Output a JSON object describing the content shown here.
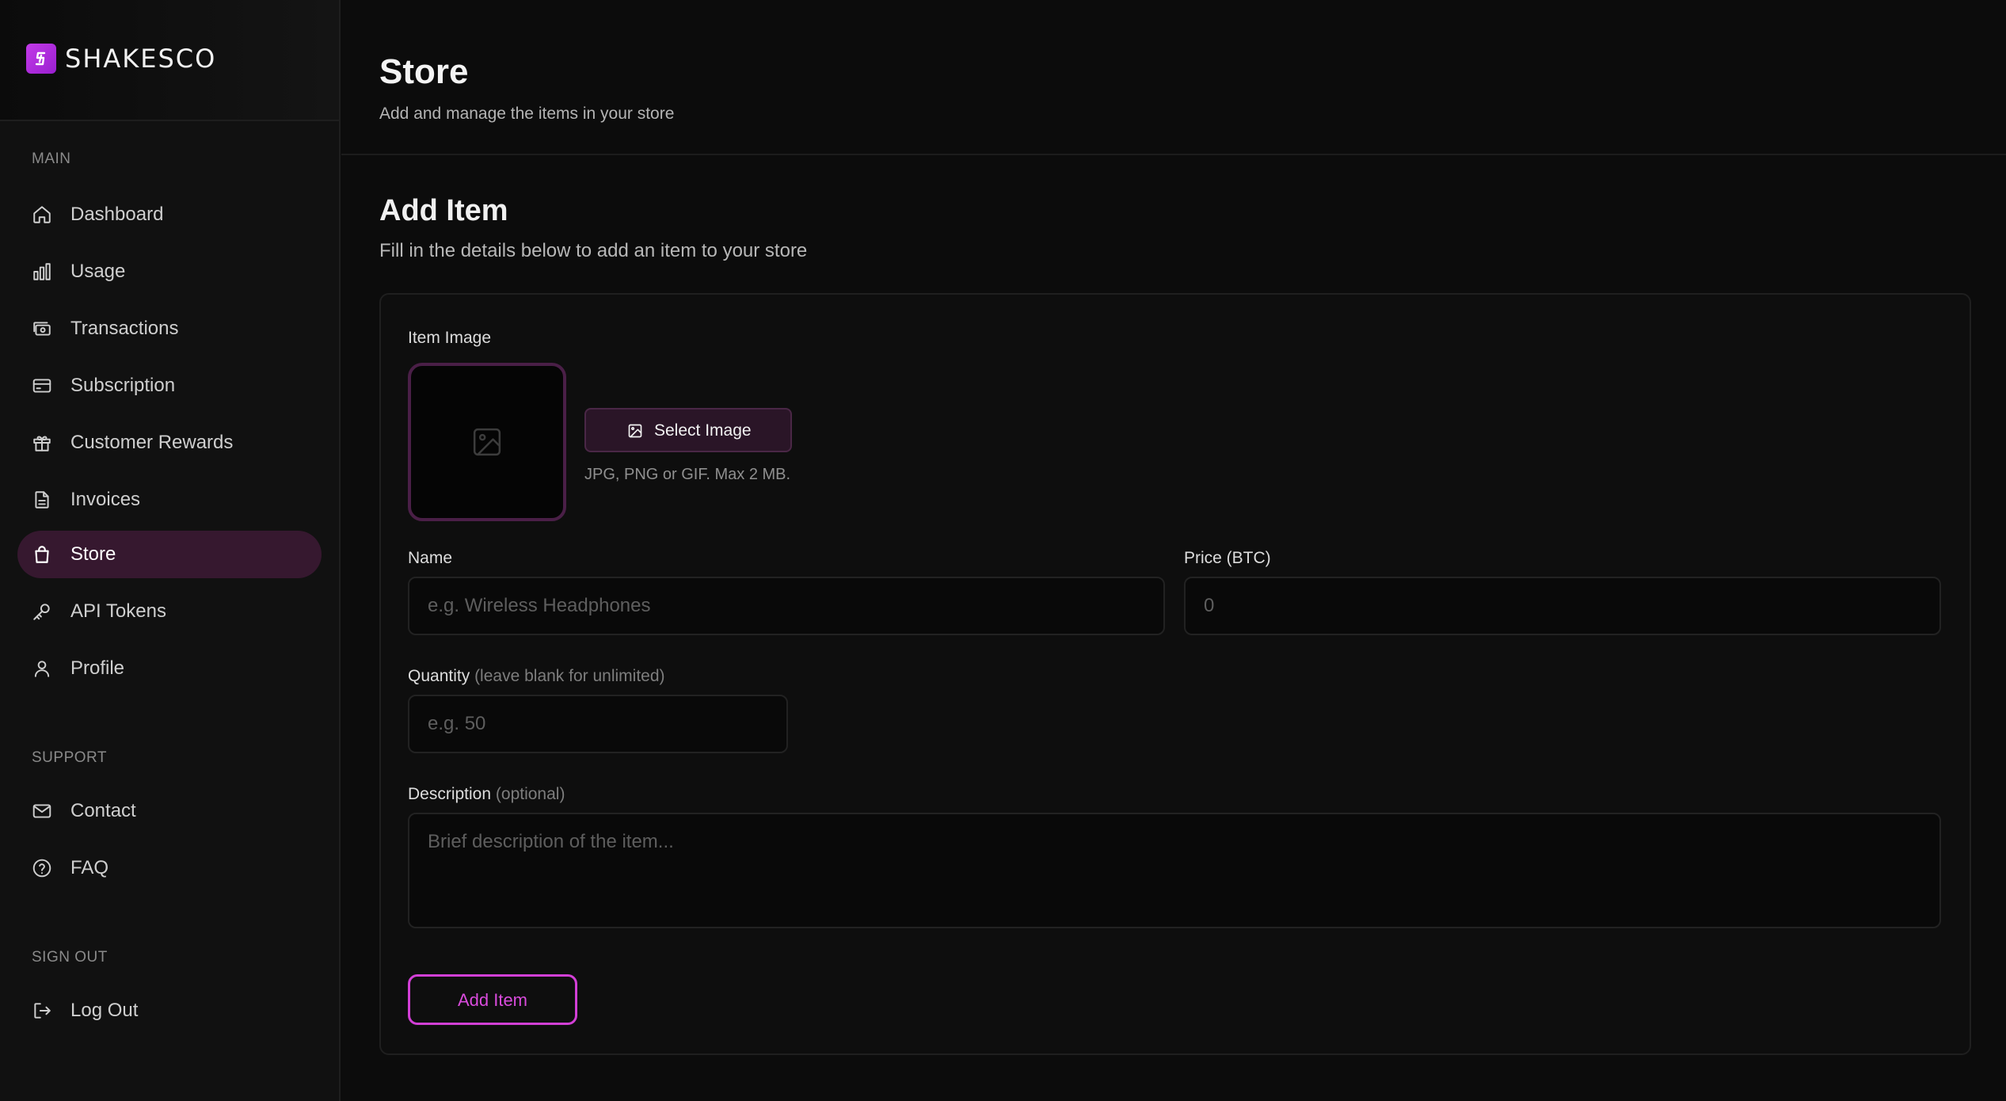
{
  "brand": {
    "name": "SHAKESCO",
    "icon": "brand-logo-icon",
    "accent": "#c23ae8"
  },
  "sidebar": {
    "sections": [
      {
        "title": "MAIN",
        "items": [
          {
            "label": "Dashboard",
            "icon": "home-icon",
            "active": false
          },
          {
            "label": "Usage",
            "icon": "bar-chart-icon",
            "active": false
          },
          {
            "label": "Transactions",
            "icon": "banknote-icon",
            "active": false
          },
          {
            "label": "Subscription",
            "icon": "credit-card-icon",
            "active": false
          },
          {
            "label": "Customer Rewards",
            "icon": "gift-icon",
            "active": false
          },
          {
            "label": "Invoices",
            "icon": "file-icon",
            "active": false
          },
          {
            "label": "Store",
            "icon": "shopping-bag-icon",
            "active": true
          },
          {
            "label": "API Tokens",
            "icon": "key-icon",
            "active": false
          },
          {
            "label": "Profile",
            "icon": "user-icon",
            "active": false
          }
        ]
      },
      {
        "title": "SUPPORT",
        "items": [
          {
            "label": "Contact",
            "icon": "mail-icon",
            "active": false
          },
          {
            "label": "FAQ",
            "icon": "help-circle-icon",
            "active": false
          }
        ]
      },
      {
        "title": "SIGN OUT",
        "items": [
          {
            "label": "Log Out",
            "icon": "log-out-icon",
            "active": false
          }
        ]
      }
    ]
  },
  "header": {
    "title": "Store",
    "subtitle": "Add and manage the items in your store"
  },
  "form": {
    "heading": "Add Item",
    "description": "Fill in the details below to add an item to your store",
    "image_label": "Item Image",
    "image_placeholder_icon": "image-icon",
    "select_image_label": "Select Image",
    "image_hint": "JPG, PNG or GIF. Max 2 MB.",
    "name_label": "Name",
    "name_placeholder": "e.g. Wireless Headphones",
    "name_value": "",
    "price_label": "Price (BTC)",
    "price_placeholder": "0",
    "price_value": "",
    "quantity_label": "Quantity",
    "quantity_note": "(leave blank for unlimited)",
    "quantity_placeholder": "e.g. 50",
    "description_label": "Description",
    "description_note": "(optional)",
    "description_placeholder": "Brief description of the item...",
    "submit_label": "Add Item"
  },
  "colors": {
    "background": "#0c0c0c",
    "sidebar": "#111111",
    "active_nav": "#36182f",
    "accent": "#d23fd6"
  }
}
